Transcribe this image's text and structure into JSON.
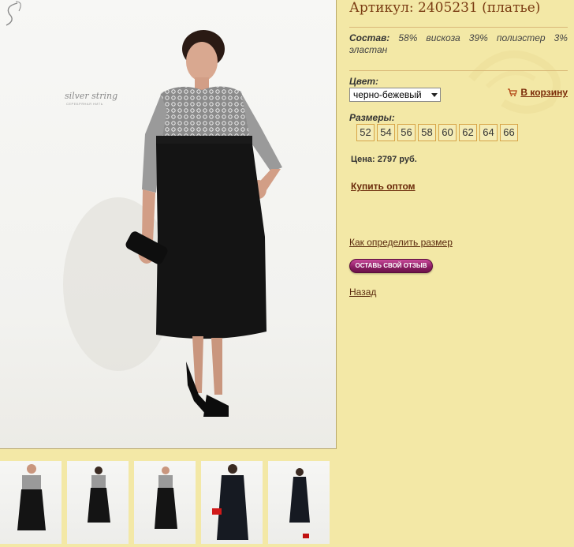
{
  "product": {
    "title": "Артикул: 2405231 (платье)",
    "composition_label": "Состав:",
    "composition_text": "58% вискоза 39% полиэстер 3% эластан",
    "color_label": "Цвет:",
    "color_selected": "черно-бежевый",
    "cart_label": "В корзину",
    "sizes_label": "Размеры:",
    "sizes": [
      "52",
      "54",
      "56",
      "58",
      "60",
      "62",
      "64",
      "66"
    ],
    "price": "Цена: 2797 руб.",
    "wholesale_link": "Купить оптом",
    "size_guide_link": "Как определить размер",
    "review_button": "ОСТАВЬ СВОЙ ОТЗЫВ",
    "back_link": "Назад"
  },
  "brand": {
    "name": "silver string",
    "tagline": "СЕРЕБРЯНАЯ НИТЬ"
  },
  "thumbnails": [
    {
      "icon": "dress-lace-top-thumbnail"
    },
    {
      "icon": "dress-lace-top-side-thumbnail"
    },
    {
      "icon": "dress-lace-top-front-thumbnail"
    },
    {
      "icon": "dress-black-red-clutch-thumbnail"
    },
    {
      "icon": "dress-black-side-thumbnail"
    }
  ],
  "colors": {
    "background": "#f3e8a6",
    "title": "#7a3b12",
    "link": "#5a2a0e",
    "size_border": "#d7a446",
    "button": "#8e1f66"
  }
}
